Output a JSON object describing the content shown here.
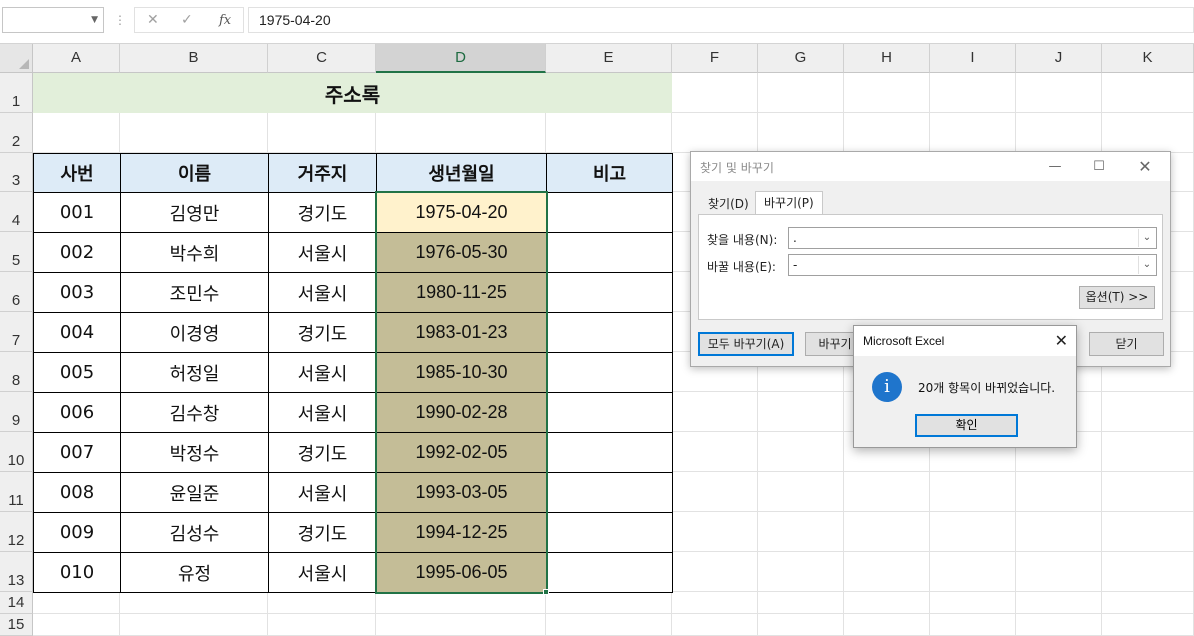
{
  "formula_bar": {
    "name_box": "",
    "fx_label": "fx",
    "formula": "1975-04-20"
  },
  "columns": [
    "A",
    "B",
    "C",
    "D",
    "E",
    "F",
    "G",
    "H",
    "I",
    "J",
    "K"
  ],
  "rows": [
    "1",
    "2",
    "3",
    "4",
    "5",
    "6",
    "7",
    "8",
    "9",
    "10",
    "11",
    "12",
    "13",
    "14",
    "15"
  ],
  "sheet": {
    "title": "주소록",
    "headers": [
      "사번",
      "이름",
      "거주지",
      "생년월일",
      "비고"
    ],
    "records": [
      [
        "001",
        "김영만",
        "경기도",
        "1975-04-20",
        ""
      ],
      [
        "002",
        "박수희",
        "서울시",
        "1976-05-30",
        ""
      ],
      [
        "003",
        "조민수",
        "서울시",
        "1980-11-25",
        ""
      ],
      [
        "004",
        "이경영",
        "경기도",
        "1983-01-23",
        ""
      ],
      [
        "005",
        "허정일",
        "서울시",
        "1985-10-30",
        ""
      ],
      [
        "006",
        "김수창",
        "서울시",
        "1990-02-28",
        ""
      ],
      [
        "007",
        "박정수",
        "경기도",
        "1992-02-05",
        ""
      ],
      [
        "008",
        "윤일준",
        "서울시",
        "1993-03-05",
        ""
      ],
      [
        "009",
        "김성수",
        "경기도",
        "1994-12-25",
        ""
      ],
      [
        "010",
        "유정",
        "서울시",
        "1995-06-05",
        ""
      ]
    ]
  },
  "find_replace": {
    "title": "찾기 및 바꾸기",
    "tab_find": "찾기(D)",
    "tab_replace": "바꾸기(P)",
    "find_label": "찾을 내용(N):",
    "find_value": ".",
    "replace_label": "바꿀 내용(E):",
    "replace_value": "-",
    "options_button": "옵션(T) >>",
    "replace_all_button": "모두 바꾸기(A)",
    "replace_button": "바꾸기",
    "close_button": "닫기"
  },
  "message_box": {
    "title": "Microsoft Excel",
    "icon": "i",
    "text": "20개 항목이 바뀌었습니다.",
    "ok_button": "확인"
  },
  "colors": {
    "title_fill": "#e2efda",
    "header_fill": "#ddebf7",
    "replaced_fill": "#c4bd97",
    "active_fill": "#fff2cc",
    "selection": "#217346"
  }
}
